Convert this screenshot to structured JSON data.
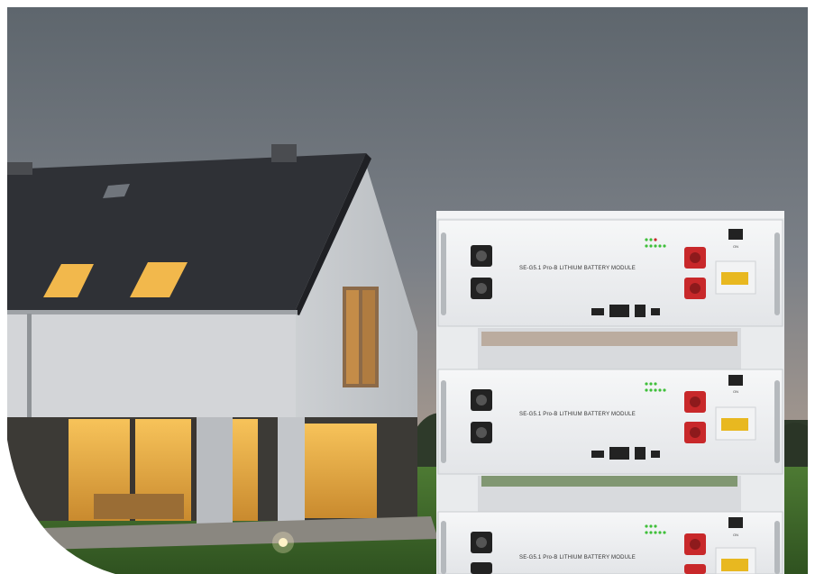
{
  "photo": {
    "subject": "house-at-dusk-with-stacked-battery-modules",
    "colors": {
      "sky_top": "#5f676e",
      "sky_bottom": "#c3a894",
      "wall": "#d6d8da",
      "roof": "#3a3c40",
      "window_glow": "#f2b54a",
      "lawn": "#3f6b2a",
      "battery_body": "#eef0f2",
      "terminal_black": "#222222",
      "terminal_red": "#c8282a",
      "led_green": "#3fbf3a",
      "breaker_yellow": "#e8b820"
    }
  },
  "battery_modules": [
    {
      "model_label": "SE-G5.1 Pro-B  LITHIUM BATTERY MODULE",
      "switch_label": "ON"
    },
    {
      "model_label": "SE-G5.1 Pro-B  LITHIUM BATTERY MODULE",
      "switch_label": "ON"
    },
    {
      "model_label": "SE-G5.1 Pro-B  LITHIUM BATTERY MODULE",
      "switch_label": "ON"
    }
  ]
}
